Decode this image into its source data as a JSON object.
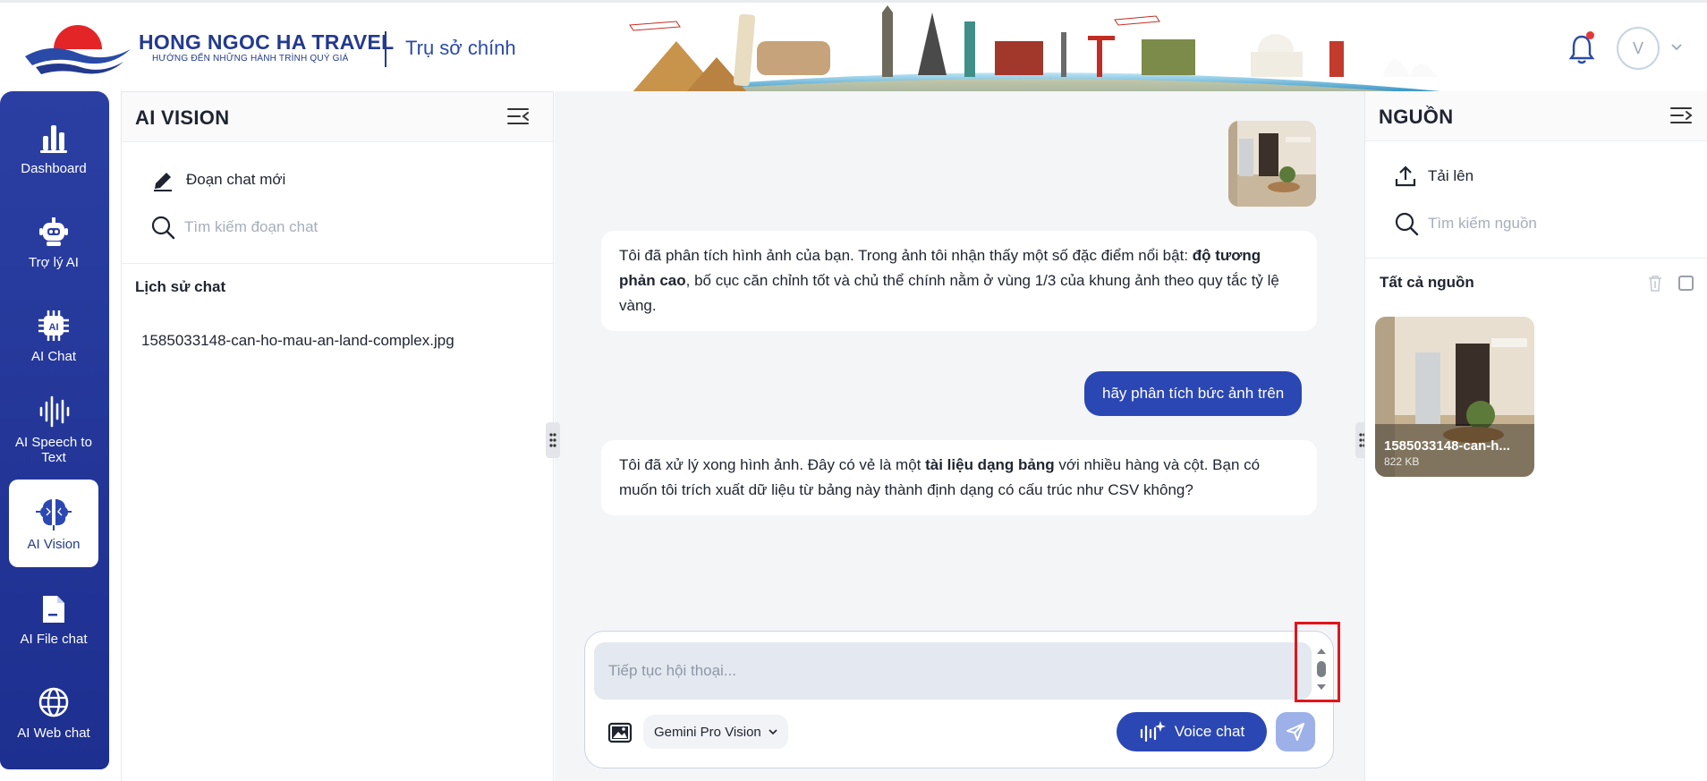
{
  "brand": {
    "name": "HONG NGOC HA TRAVEL",
    "tagline": "HƯỚNG ĐẾN NHỮNG HÀNH TRÌNH QUÝ GIÁ",
    "branch": "Trụ sở chính",
    "primary_color": "#233a8e",
    "accent_color": "#e42528"
  },
  "user": {
    "avatar_initial": "V",
    "has_notification": true
  },
  "nav": {
    "items": [
      {
        "label": "Dashboard",
        "icon": "bar-chart-icon",
        "active": false
      },
      {
        "label": "Trợ lý AI",
        "icon": "robot-icon",
        "active": false
      },
      {
        "label": "AI Chat",
        "icon": "chip-icon",
        "active": false
      },
      {
        "label": "AI Speech to Text",
        "icon": "sound-wave-icon",
        "active": false
      },
      {
        "label": "AI Vision",
        "icon": "brain-icon",
        "active": true
      },
      {
        "label": "AI File chat",
        "icon": "file-icon",
        "active": false
      },
      {
        "label": "AI Web chat",
        "icon": "globe-icon",
        "active": false
      }
    ]
  },
  "history_panel": {
    "title": "AI VISION",
    "new_chat_label": "Đoạn chat mới",
    "search_placeholder": "Tìm kiếm đoạn chat",
    "history_label": "Lịch sử chat",
    "history_items": [
      "1585033148-can-ho-mau-an-land-complex.jpg"
    ]
  },
  "chat": {
    "messages": [
      {
        "role": "user",
        "type": "image"
      },
      {
        "role": "assistant",
        "parts": [
          {
            "text": "Tôi đã phân tích hình ảnh của bạn. Trong ảnh tôi nhận thấy một số đặc điểm nổi bật: ",
            "bold": false
          },
          {
            "text": "độ tương phản cao",
            "bold": true
          },
          {
            "text": ", bố cục căn chỉnh tốt và chủ thể chính nằm ở vùng 1/3 của khung ảnh theo quy tắc tỷ lệ vàng.",
            "bold": false
          }
        ]
      },
      {
        "role": "user",
        "text": "hãy phân tích bức ảnh trên"
      },
      {
        "role": "assistant",
        "parts": [
          {
            "text": "Tôi đã xử lý xong hình ảnh. Đây có vẻ là một ",
            "bold": false
          },
          {
            "text": "tài liệu dạng bảng",
            "bold": true
          },
          {
            "text": " với nhiều hàng và cột. Bạn có muốn tôi trích xuất dữ liệu từ bảng này thành định dạng có cấu trúc như CSV không?",
            "bold": false
          }
        ]
      }
    ]
  },
  "composer": {
    "placeholder": "Tiếp tục hội thoại...",
    "model": "Gemini Pro Vision",
    "voice_label": "Voice chat"
  },
  "sources_panel": {
    "title": "NGUỒN",
    "upload_label": "Tải lên",
    "search_placeholder": "Tìm kiếm nguồn",
    "all_label": "Tất cả nguồn",
    "files": [
      {
        "name": "1585033148-can-h...",
        "size": "822 KB"
      }
    ]
  }
}
